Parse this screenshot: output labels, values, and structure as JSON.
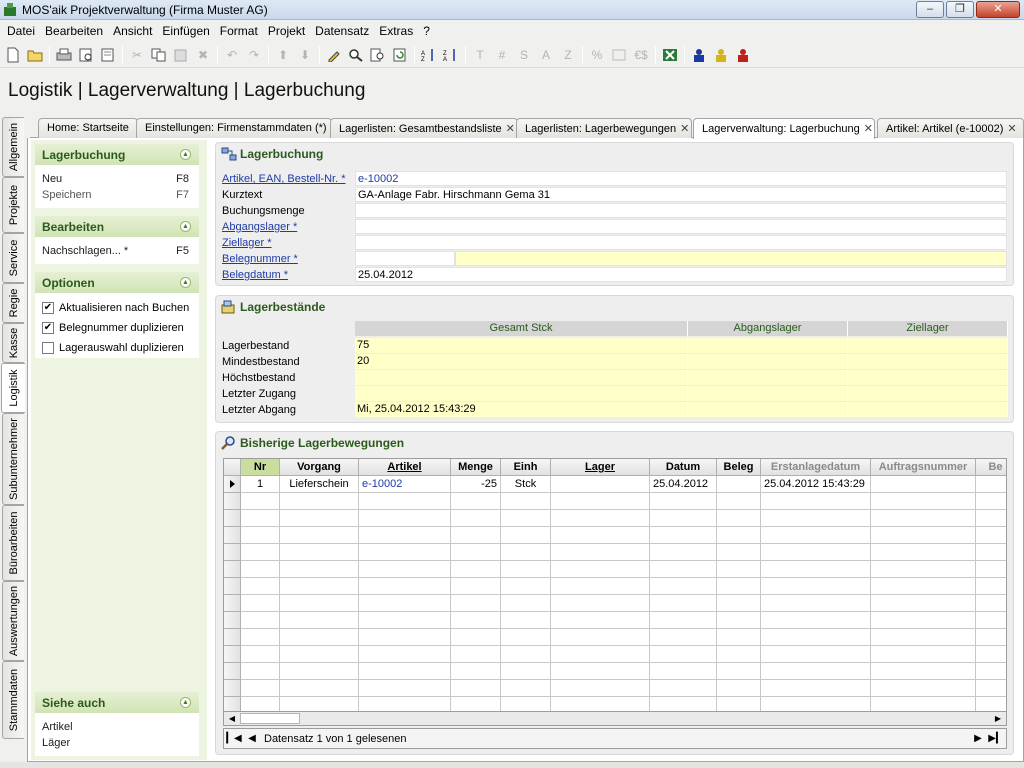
{
  "window": {
    "title": "MOS'aik Projektverwaltung (Firma Muster AG)"
  },
  "menu": [
    "Datei",
    "Bearbeiten",
    "Ansicht",
    "Einfügen",
    "Format",
    "Projekt",
    "Datensatz",
    "Extras",
    "?"
  ],
  "toolbar": {
    "text_buttons": [
      "T",
      "#",
      "S",
      "A",
      "Z",
      "%",
      "€$"
    ],
    "icons": [
      "new-doc-icon",
      "open-folder-icon",
      "print-icon",
      "print-preview-icon",
      "page-preview-icon",
      "cut-icon",
      "copy-icon",
      "paste-icon",
      "delete-icon",
      "undo-icon",
      "redo-icon",
      "arrow-up-icon",
      "arrow-down-icon",
      "edit-pencil-icon",
      "search-icon",
      "search-doc-icon",
      "refresh-icon",
      "sort-asc-icon",
      "sort-desc-icon",
      "excel-icon",
      "user-blue-icon",
      "user-yellow-icon",
      "user-red-icon"
    ]
  },
  "page_title": "Logistik | Lagerverwaltung | Lagerbuchung",
  "vertical_tabs": [
    "Allgemein",
    "Projekte",
    "Service",
    "Regie",
    "Kasse",
    "Logistik",
    "Subunternehmer",
    "Büroarbeiten",
    "Auswertungen",
    "Stammdaten"
  ],
  "active_vertical_tab": "Logistik",
  "doc_tabs": [
    {
      "label": "Home: Startseite",
      "closable": false
    },
    {
      "label": "Einstellungen: Firmenstammdaten (*)",
      "closable": false
    },
    {
      "label": "Lagerlisten: Gesamtbestandsliste",
      "closable": true
    },
    {
      "label": "Lagerlisten: Lagerbewegungen",
      "closable": true
    },
    {
      "label": "Lagerverwaltung: Lagerbuchung",
      "closable": true,
      "active": true
    },
    {
      "label": "Artikel: Artikel (e-10002)",
      "closable": true
    }
  ],
  "left_panel": {
    "lagerbuchung": {
      "title": "Lagerbuchung",
      "items": [
        {
          "label": "Neu",
          "key": "F8"
        },
        {
          "label": "Speichern",
          "key": "F7"
        }
      ]
    },
    "bearbeiten": {
      "title": "Bearbeiten",
      "items": [
        {
          "label": "Nachschlagen... *",
          "key": "F5"
        }
      ]
    },
    "optionen": {
      "title": "Optionen",
      "options": [
        {
          "label": "Aktualisieren nach Buchen",
          "checked": true
        },
        {
          "label": "Belegnummer duplizieren",
          "checked": true
        },
        {
          "label": "Lagerauswahl duplizieren",
          "checked": false
        }
      ]
    },
    "siehe_auch": {
      "title": "Siehe auch",
      "items": [
        "Artikel",
        "Läger"
      ]
    }
  },
  "lagerbuchung_form": {
    "title": "Lagerbuchung",
    "fields": [
      {
        "label": "Artikel, EAN, Bestell-Nr. *",
        "value": "e-10002",
        "link": true
      },
      {
        "label": "Kurztext",
        "value": "GA-Anlage Fabr. Hirschmann Gema 31",
        "link": false
      },
      {
        "label": "Buchungsmenge",
        "value": "",
        "link": false
      },
      {
        "label": "Abgangslager *",
        "value": "",
        "link": true
      },
      {
        "label": "Ziellager *",
        "value": "",
        "link": true
      },
      {
        "label": "Belegnummer *",
        "value": "",
        "link": true
      },
      {
        "label": "Belegdatum *",
        "value": "25.04.2012",
        "link": true
      }
    ]
  },
  "lagerbestaende": {
    "title": "Lagerbestände",
    "columns": [
      "Gesamt Stck",
      "Abgangslager",
      "Ziellager"
    ],
    "rows": [
      {
        "label": "Lagerbestand",
        "values": [
          "75",
          "",
          ""
        ]
      },
      {
        "label": "Mindestbestand",
        "values": [
          "20",
          "",
          ""
        ]
      },
      {
        "label": "Höchstbestand",
        "values": [
          "",
          "",
          ""
        ]
      },
      {
        "label": "Letzter Zugang",
        "values": [
          "",
          "",
          ""
        ]
      },
      {
        "label": "Letzter Abgang",
        "values": [
          "Mi, 25.04.2012 15:43:29",
          "",
          ""
        ]
      }
    ]
  },
  "bewegungen": {
    "title": "Bisherige Lagerbewegungen",
    "columns": [
      "Nr",
      "Vorgang",
      "Artikel",
      "Menge",
      "Einh",
      "Lager",
      "Datum",
      "Beleg",
      "Erstanlagedatum",
      "Auftragsnummer",
      "Be"
    ],
    "rows": [
      [
        "1",
        "Lieferschein",
        "e-10002",
        "-25",
        "Stck",
        "",
        "25.04.2012",
        "",
        "25.04.2012 15:43:29",
        "",
        ""
      ]
    ],
    "status": "Datensatz 1 von 1 gelesenen"
  }
}
